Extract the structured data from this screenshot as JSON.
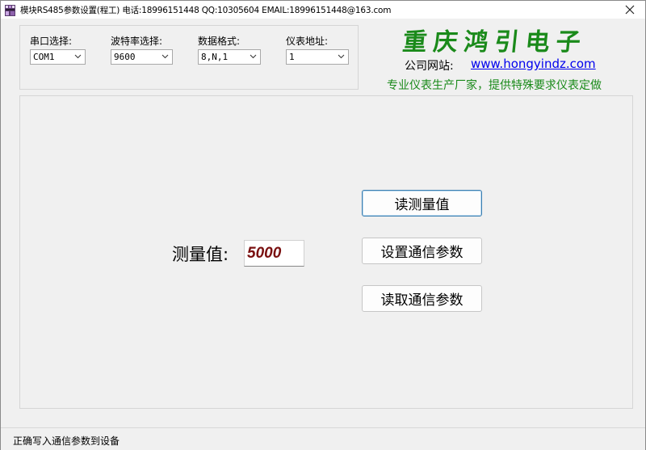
{
  "window": {
    "title": "模块RS485参数设置(程工)  电话:18996151448  QQ:10305604  EMAIL:18996151448@163.com",
    "icon": "app-icon",
    "close_icon": "close-icon"
  },
  "settings": {
    "port": {
      "label": "串口选择:",
      "value": "COM1"
    },
    "baud": {
      "label": "波特率选择:",
      "value": "9600"
    },
    "format": {
      "label": "数据格式:",
      "value": "8,N,1"
    },
    "address": {
      "label": "仪表地址:",
      "value": "1"
    }
  },
  "company": {
    "name": "重庆鸿引电子",
    "website_label": "公司网站:",
    "website_url": "www.hongyindz.com",
    "tagline": "专业仪表生产厂家，提供特殊要求仪表定做",
    "accent_color": "#1a8a1a",
    "link_color": "#0000ee"
  },
  "measurement": {
    "label": "测量值:",
    "value": "5000",
    "value_color": "#7a1010"
  },
  "buttons": {
    "read_measure": "读测量值",
    "set_comm": "设置通信参数",
    "read_comm": "读取通信参数"
  },
  "status": {
    "text": "正确写入通信参数到设备"
  }
}
